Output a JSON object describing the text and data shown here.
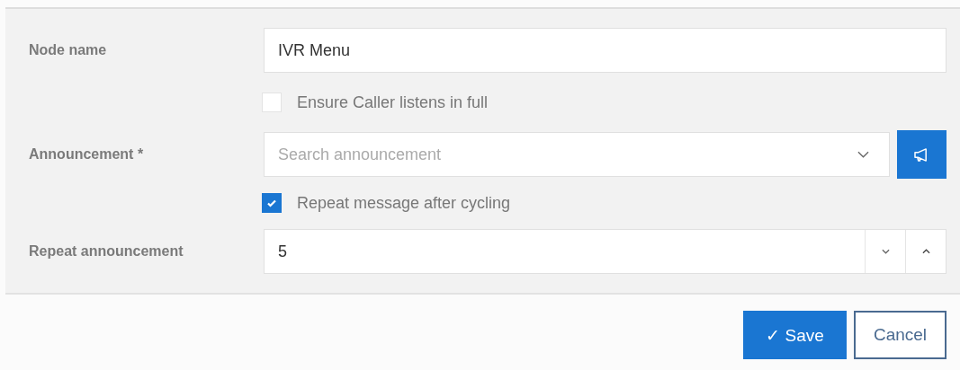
{
  "form": {
    "node_name": {
      "label": "Node name",
      "value": "IVR Menu"
    },
    "ensure_full": {
      "label": "Ensure Caller listens in full",
      "checked": false
    },
    "announcement": {
      "label": "Announcement *",
      "placeholder": "Search announcement"
    },
    "repeat_after_cycling": {
      "label": "Repeat message after cycling",
      "checked": true
    },
    "repeat_announcement": {
      "label": "Repeat announcement",
      "value": "5"
    }
  },
  "buttons": {
    "save": "✓ Save",
    "cancel": "Cancel"
  }
}
